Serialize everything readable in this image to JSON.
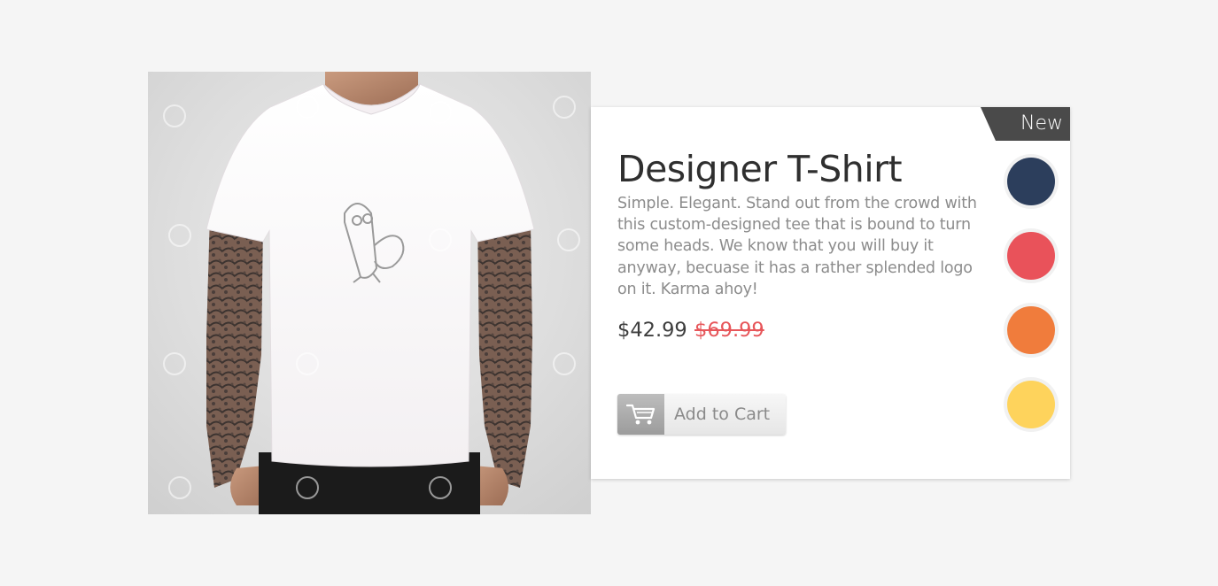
{
  "product": {
    "badge": "New",
    "title": "Designer T-Shirt",
    "description": "Simple. Elegant. Stand out from the crowd with this custom-designed tee that is bound to turn some heads. We know that you will buy it anyway, becuase it has a rather splended logo on it. Karma ahoy!",
    "price": "$42.99",
    "original_price": "$69.99",
    "add_to_cart_label": "Add to Cart",
    "image_icon": "tshirt-photo",
    "cart_icon": "shopping-cart-icon"
  },
  "colors": [
    {
      "name": "navy",
      "hex": "#2c3e5c"
    },
    {
      "name": "red",
      "hex": "#e9525a"
    },
    {
      "name": "orange",
      "hex": "#f07c3c"
    },
    {
      "name": "yellow",
      "hex": "#fed35c"
    }
  ],
  "theme": {
    "badge_bg": "#4a4a4a",
    "sale_color": "#e7565a",
    "background": "#f5f5f5"
  }
}
